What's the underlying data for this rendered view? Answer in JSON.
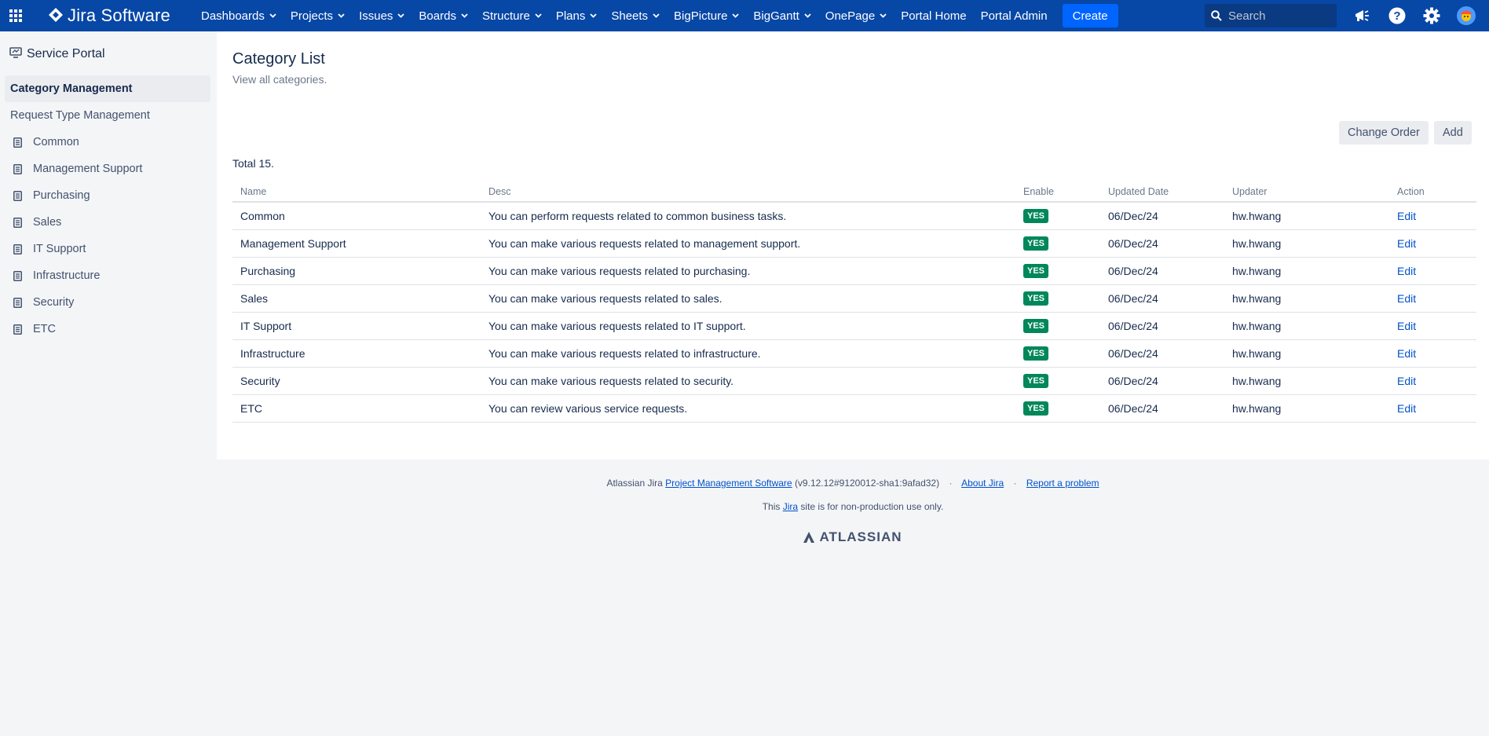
{
  "topnav": {
    "brand": "Jira Software",
    "items": [
      {
        "label": "Dashboards",
        "dropdown": true
      },
      {
        "label": "Projects",
        "dropdown": true
      },
      {
        "label": "Issues",
        "dropdown": true
      },
      {
        "label": "Boards",
        "dropdown": true
      },
      {
        "label": "Structure",
        "dropdown": true
      },
      {
        "label": "Plans",
        "dropdown": true
      },
      {
        "label": "Sheets",
        "dropdown": true
      },
      {
        "label": "BigPicture",
        "dropdown": true
      },
      {
        "label": "BigGantt",
        "dropdown": true
      },
      {
        "label": "OnePage",
        "dropdown": true
      },
      {
        "label": "Portal Home",
        "dropdown": false
      },
      {
        "label": "Portal Admin",
        "dropdown": false
      }
    ],
    "create_label": "Create",
    "search_placeholder": "Search",
    "icons": [
      "app-switcher-icon",
      "jira-logo-icon",
      "notifications-megaphone-icon",
      "help-icon",
      "settings-gear-icon",
      "user-avatar-icon"
    ],
    "bg_color": "#0747a6",
    "create_color": "#0065ff"
  },
  "sidebar": {
    "title": "Service Portal",
    "links": [
      {
        "label": "Category Management",
        "active": true
      },
      {
        "label": "Request Type Management",
        "active": false
      }
    ],
    "sub_items": [
      "Common",
      "Management Support",
      "Purchasing",
      "Sales",
      "IT Support",
      "Infrastructure",
      "Security",
      "ETC"
    ]
  },
  "main": {
    "title": "Category List",
    "subtitle": "View all categories.",
    "change_order_label": "Change Order",
    "add_label": "Add",
    "total": "Total 15."
  },
  "table": {
    "headers": [
      "Name",
      "Desc",
      "Enable",
      "Updated Date",
      "Updater",
      "Action"
    ],
    "rows": [
      {
        "name": "Common",
        "desc": "You can perform requests related to common business tasks.",
        "enable": "YES",
        "date": "06/Dec/24",
        "updater": "hw.hwang",
        "action": "Edit"
      },
      {
        "name": "Management Support",
        "desc": "You can make various requests related to management support.",
        "enable": "YES",
        "date": "06/Dec/24",
        "updater": "hw.hwang",
        "action": "Edit"
      },
      {
        "name": "Purchasing",
        "desc": "You can make various requests related to purchasing.",
        "enable": "YES",
        "date": "06/Dec/24",
        "updater": "hw.hwang",
        "action": "Edit"
      },
      {
        "name": "Sales",
        "desc": "You can make various requests related to sales.",
        "enable": "YES",
        "date": "06/Dec/24",
        "updater": "hw.hwang",
        "action": "Edit"
      },
      {
        "name": "IT Support",
        "desc": "You can make various requests related to IT support.",
        "enable": "YES",
        "date": "06/Dec/24",
        "updater": "hw.hwang",
        "action": "Edit"
      },
      {
        "name": "Infrastructure",
        "desc": "You can make various requests related to infrastructure.",
        "enable": "YES",
        "date": "06/Dec/24",
        "updater": "hw.hwang",
        "action": "Edit"
      },
      {
        "name": "Security",
        "desc": "You can make various requests related to security.",
        "enable": "YES",
        "date": "06/Dec/24",
        "updater": "hw.hwang",
        "action": "Edit"
      },
      {
        "name": "ETC",
        "desc": "You can review various service requests.",
        "enable": "YES",
        "date": "06/Dec/24",
        "updater": "hw.hwang",
        "action": "Edit"
      }
    ],
    "yes_color": "#00875a",
    "link_color": "#0052cc"
  },
  "footer": {
    "prefix": "Atlassian Jira",
    "pms_link": "Project Management Software",
    "version": "(v9.12.12#9120012-sha1:9afad32)",
    "about_link": "About Jira",
    "report_link": "Report a problem",
    "line2_pre": "This",
    "line2_link": "Jira",
    "line2_post": "site is for non-production use only.",
    "brand": "ATLASSIAN",
    "separator": "·"
  }
}
